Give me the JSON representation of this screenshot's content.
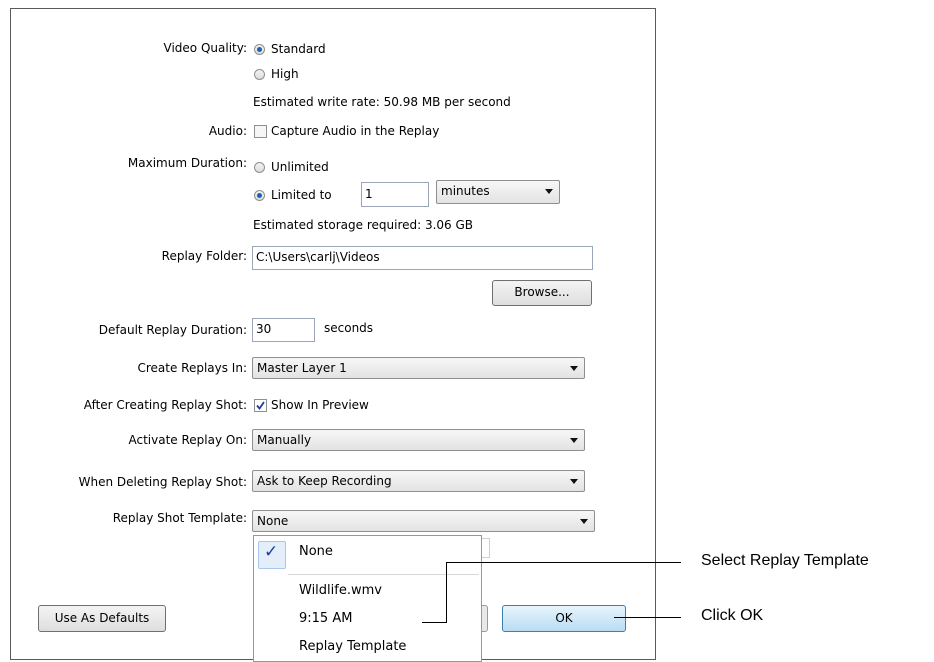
{
  "video_quality": {
    "label": "Video Quality:",
    "options": [
      "Standard",
      "High"
    ],
    "selected": "Standard",
    "write_rate": "Estimated write rate: 50.98 MB per second"
  },
  "audio": {
    "label": "Audio:",
    "checkbox_label": "Capture Audio in the Replay",
    "checked": false
  },
  "max_duration": {
    "label": "Maximum Duration:",
    "unlimited_label": "Unlimited",
    "limited_label": "Limited to",
    "selected": "Limited to",
    "value": "1",
    "unit": "minutes",
    "storage": "Estimated storage required: 3.06 GB"
  },
  "replay_folder": {
    "label": "Replay Folder:",
    "value": "C:\\Users\\carlj\\Videos",
    "browse_label": "Browse..."
  },
  "default_duration": {
    "label": "Default Replay Duration:",
    "value": "30",
    "unit": "seconds"
  },
  "create_in": {
    "label": "Create Replays In:",
    "value": "Master Layer 1"
  },
  "after_creating": {
    "label": "After Creating Replay Shot:",
    "checkbox_label": "Show In Preview",
    "checked": true
  },
  "activate_on": {
    "label": "Activate Replay On:",
    "value": "Manually"
  },
  "when_deleting": {
    "label": "When Deleting Replay Shot:",
    "value": "Ask to Keep Recording"
  },
  "template": {
    "label": "Replay Shot Template:",
    "value": "None"
  },
  "template_menu": {
    "items": [
      "None",
      "Wildlife.wmv",
      "9:15 AM",
      "Replay Template"
    ],
    "checked": "None"
  },
  "buttons": {
    "use_defaults": "Use As Defaults",
    "ok": "OK"
  },
  "callouts": {
    "select_template": "Select Replay Template",
    "click_ok": "Click OK"
  },
  "colors": {
    "accent": "#1c5fb5",
    "ok_button": "#b8dcf2"
  }
}
